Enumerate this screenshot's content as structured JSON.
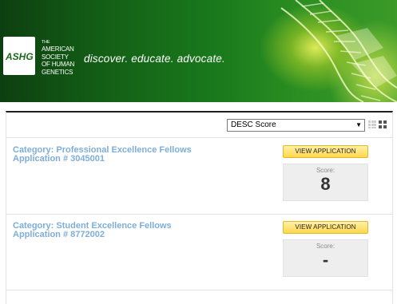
{
  "banner": {
    "logo_text": "ASHG",
    "org_lines": [
      "THE",
      "AMERICAN",
      "SOCIETY",
      "OF HUMAN",
      "GENETICS"
    ],
    "tagline": "discover. educate. advocate."
  },
  "toolbar": {
    "sort_value": "DESC Score",
    "sort_arrow": "▼",
    "view_list_icon": "list-view-icon",
    "view_grid_icon": "grid-view-icon"
  },
  "applications": [
    {
      "category": "Category: Professional Excellence Fellows",
      "number": "Application # 3045001",
      "button": "VIEW APPLICATION",
      "score_label": "Score:",
      "score": "8"
    },
    {
      "category": "Category: Student Excellence Fellows",
      "number": "Application # 8772002",
      "button": "VIEW APPLICATION",
      "score_label": "Score:",
      "score": "-"
    }
  ],
  "colors": {
    "link_blue": "#7daed9",
    "button_yellow": "#ffd84a",
    "banner_green": "#135e16"
  }
}
